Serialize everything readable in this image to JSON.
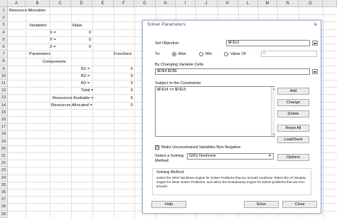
{
  "sheet": {
    "columns": [
      "A",
      "B",
      "C",
      "D",
      "E",
      "F",
      "G",
      "H",
      "I",
      "J",
      "K",
      "L",
      "M",
      "N",
      "O"
    ],
    "rows": [
      "1",
      "2",
      "3",
      "4",
      "5",
      "6",
      "7",
      "8",
      "9",
      "10",
      "11",
      "12",
      "13",
      "14",
      "15",
      "16",
      "17",
      "18",
      "19",
      "20",
      "21",
      "22",
      "23",
      "24",
      "25",
      "26",
      "27",
      "28",
      "29"
    ],
    "title": "Resource Allocation",
    "variables_label": "Variables:",
    "value_label": "Value",
    "x_label": "X =",
    "y_label": "Y =",
    "z_label": "Z =",
    "x_value": "0",
    "y_value": "0",
    "z_value": "0",
    "parameters_label": "Parameters",
    "functions_label": "Functions",
    "components_label": "Components",
    "b1_label": "B1 =",
    "b2_label": "B2 =",
    "b3_label": "B3 =",
    "total_label": "Total =",
    "res_avail_label": "Resources Available =",
    "res_alloc_label": "Resources Allocated =",
    "b1_value": "0",
    "b2_value": "0",
    "b3_value": "0",
    "total_value": "0",
    "res_avail_value": "6",
    "res_alloc_value": "0"
  },
  "dialog": {
    "title": "Solver Parameters",
    "close_glyph": "×",
    "set_objective_label": "Set Objective:",
    "objective_value": "$F$12",
    "to_label": "To:",
    "max_label": "Max",
    "min_label": "Min",
    "value_of_label": "Value Of:",
    "value_of_value": "0",
    "changing_cells_label": "By Changing Variable Cells:",
    "changing_cells_value": "$D$4:$D$6",
    "constraints_label": "Subject to the Constraints:",
    "constraints": [
      "$F$14 <= $F$15"
    ],
    "add_label": "Add",
    "change_label": "Change",
    "delete_label": "Delete",
    "reset_label": "Reset All",
    "loadsave_label": "Load/Save",
    "nonneg_label": "Make Unconstrained Variables Non-Negative",
    "nonneg_checked": true,
    "method_label_1": "Select a Solving",
    "method_label_2": "Method:",
    "method_value": "GRG Nonlinear",
    "options_label": "Options",
    "solving_method_title": "Solving Method",
    "solving_method_text": "Select the GRG Nonlinear engine for Solver Problems that are smooth nonlinear. Select the LP Simplex engine for linear Solver Problems, and select the Evolutionary engine for Solver problems that are non-smooth.",
    "help_label": "Help",
    "solve_label": "Solve",
    "close_label": "Close"
  }
}
